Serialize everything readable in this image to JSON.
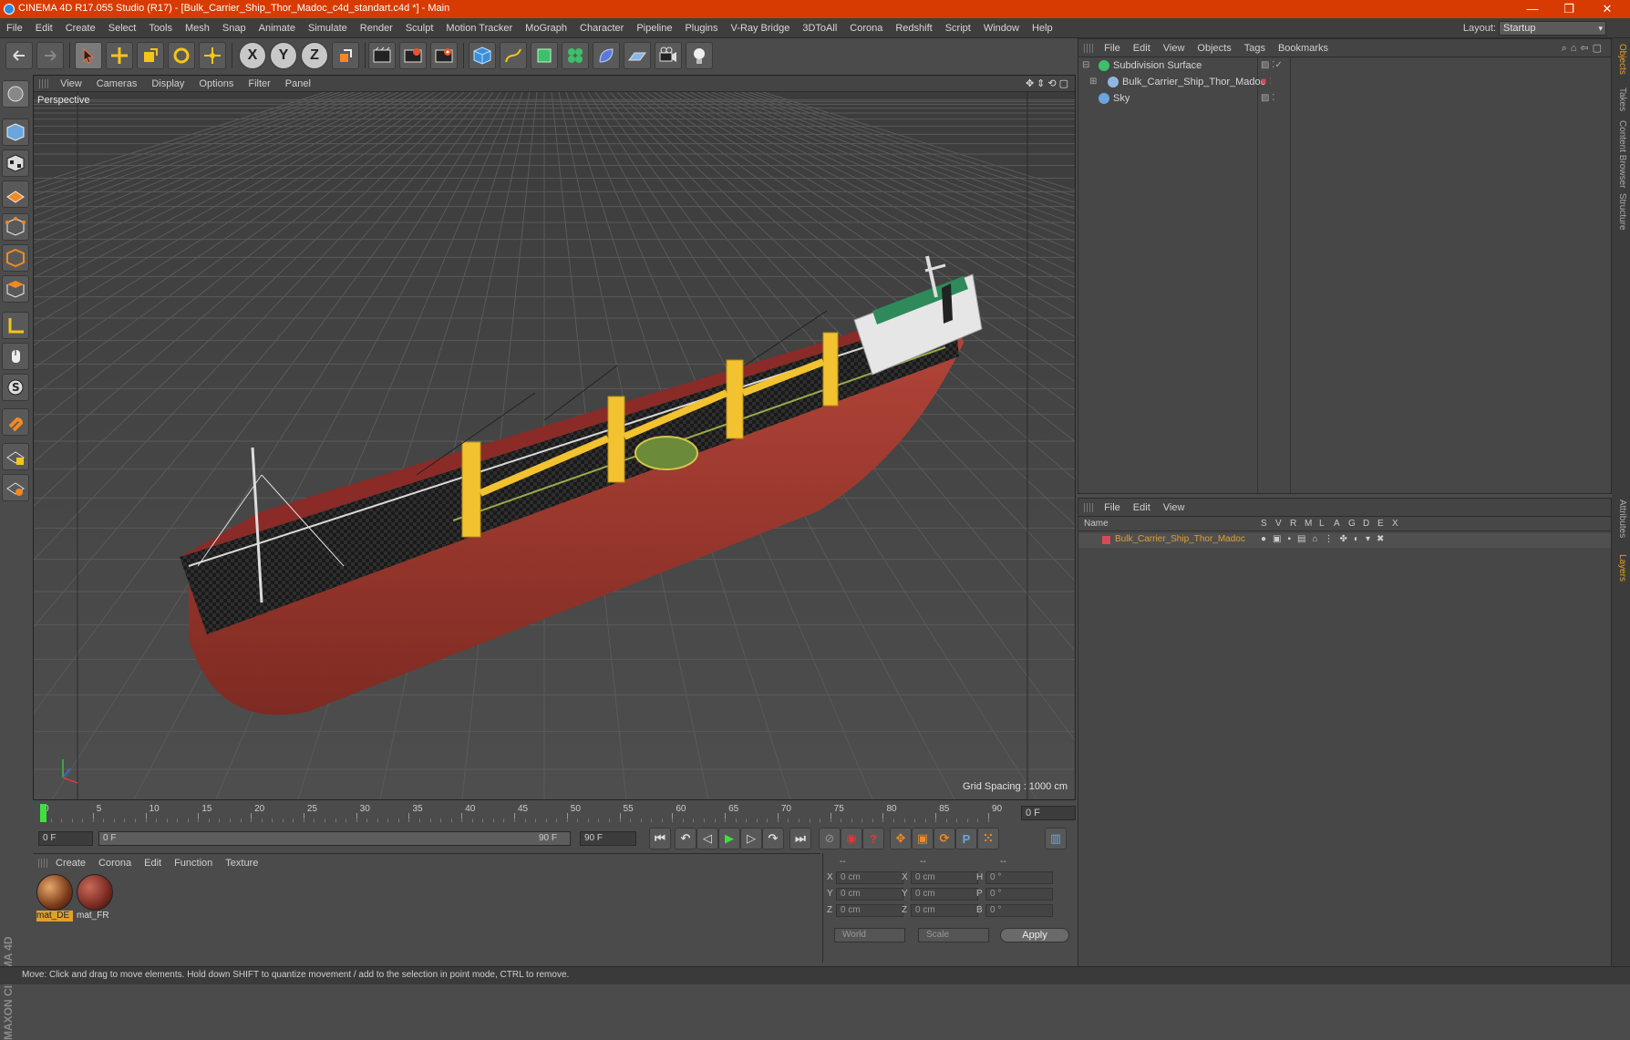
{
  "window": {
    "title": "CINEMA 4D R17.055 Studio (R17) - [Bulk_Carrier_Ship_Thor_Madoc_c4d_standart.c4d *] - Main"
  },
  "menubar": {
    "items": [
      "File",
      "Edit",
      "Create",
      "Select",
      "Tools",
      "Mesh",
      "Snap",
      "Animate",
      "Simulate",
      "Render",
      "Sculpt",
      "Motion Tracker",
      "MoGraph",
      "Character",
      "Pipeline",
      "Plugins",
      "V-Ray Bridge",
      "3DToAll",
      "Corona",
      "Redshift",
      "Script",
      "Window",
      "Help"
    ],
    "layout_label": "Layout:",
    "layout_value": "Startup"
  },
  "toolbar": {
    "x_axis": "X",
    "y_axis": "Y",
    "z_axis": "Z"
  },
  "viewport": {
    "menu": [
      "View",
      "Cameras",
      "Display",
      "Options",
      "Filter",
      "Panel"
    ],
    "label": "Perspective",
    "grid_spacing": "Grid Spacing : 1000 cm"
  },
  "timeline": {
    "ticks": [
      "0",
      "5",
      "10",
      "15",
      "20",
      "25",
      "30",
      "35",
      "40",
      "45",
      "50",
      "55",
      "60",
      "65",
      "70",
      "75",
      "80",
      "85",
      "90"
    ],
    "current_frame": "0 F"
  },
  "playbar": {
    "start": "0 F",
    "slider_start": "0 F",
    "slider_end": "90 F",
    "end": "90 F"
  },
  "materials": {
    "menu": [
      "Create",
      "Corona",
      "Edit",
      "Function",
      "Texture"
    ],
    "items": [
      {
        "name": "mat_DE"
      },
      {
        "name": "mat_FR"
      }
    ]
  },
  "coordinates": {
    "headers": [
      "--",
      "--",
      "--"
    ],
    "rows": [
      {
        "a": "X",
        "av": "0 cm",
        "b": "X",
        "bv": "0 cm",
        "c": "H",
        "cv": "0 °"
      },
      {
        "a": "Y",
        "av": "0 cm",
        "b": "Y",
        "bv": "0 cm",
        "c": "P",
        "cv": "0 °"
      },
      {
        "a": "Z",
        "av": "0 cm",
        "b": "Z",
        "bv": "0 cm",
        "c": "B",
        "cv": "0 °"
      }
    ],
    "world": "World",
    "scale": "Scale",
    "apply": "Apply"
  },
  "objects": {
    "menu": [
      "File",
      "Edit",
      "View",
      "Objects",
      "Tags",
      "Bookmarks"
    ],
    "tree": [
      {
        "name": "Subdivision Surface",
        "color": "#3fbf6a"
      },
      {
        "name": "Bulk_Carrier_Ship_Thor_Madoc",
        "color": "#8fb8e0"
      },
      {
        "name": "Sky",
        "color": "#6aa6dd"
      }
    ]
  },
  "layers": {
    "menu": [
      "File",
      "Edit",
      "View"
    ],
    "col_name": "Name",
    "cols": [
      "S",
      "V",
      "R",
      "M",
      "L",
      "A",
      "G",
      "D",
      "E",
      "X"
    ],
    "row": "Bulk_Carrier_Ship_Thor_Madoc",
    "row_color": "#e0a030"
  },
  "sidetabs": [
    "Objects",
    "Takes",
    "Content Browser",
    "Structure",
    "Attributes",
    "Layers"
  ],
  "brand": "MAXON CINEMA 4D",
  "status": "Move: Click and drag to move elements. Hold down SHIFT to quantize movement / add to the selection in point mode, CTRL to remove."
}
